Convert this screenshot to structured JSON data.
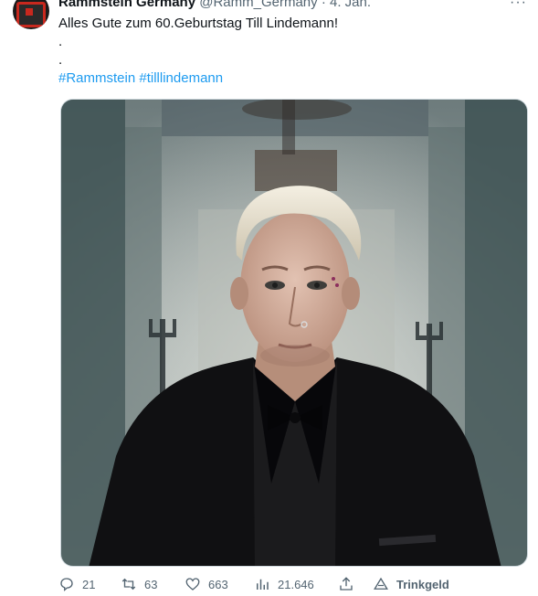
{
  "tweet": {
    "author_name": "Rammstein Germany",
    "author_handle": "@Ramm_Germany",
    "separator": "·",
    "date": "4. Jan.",
    "more_label": "···",
    "text_line1": "Alles Gute zum 60.Geburtstag Till Lindemann!",
    "text_line2": ".",
    "text_line3": ".",
    "hashtags": [
      "#Rammstein",
      "#tilllindemann"
    ]
  },
  "actions": {
    "replies": "21",
    "retweets": "63",
    "likes": "663",
    "views": "21.646",
    "tip_label": "Trinkgeld"
  },
  "icons": {
    "reply": "reply-icon",
    "retweet": "retweet-icon",
    "like": "heart-icon",
    "views": "views-icon",
    "share": "share-icon",
    "tip": "tip-icon"
  },
  "colors": {
    "hashtag": "#1d9bf0",
    "meta_text": "#536471"
  }
}
